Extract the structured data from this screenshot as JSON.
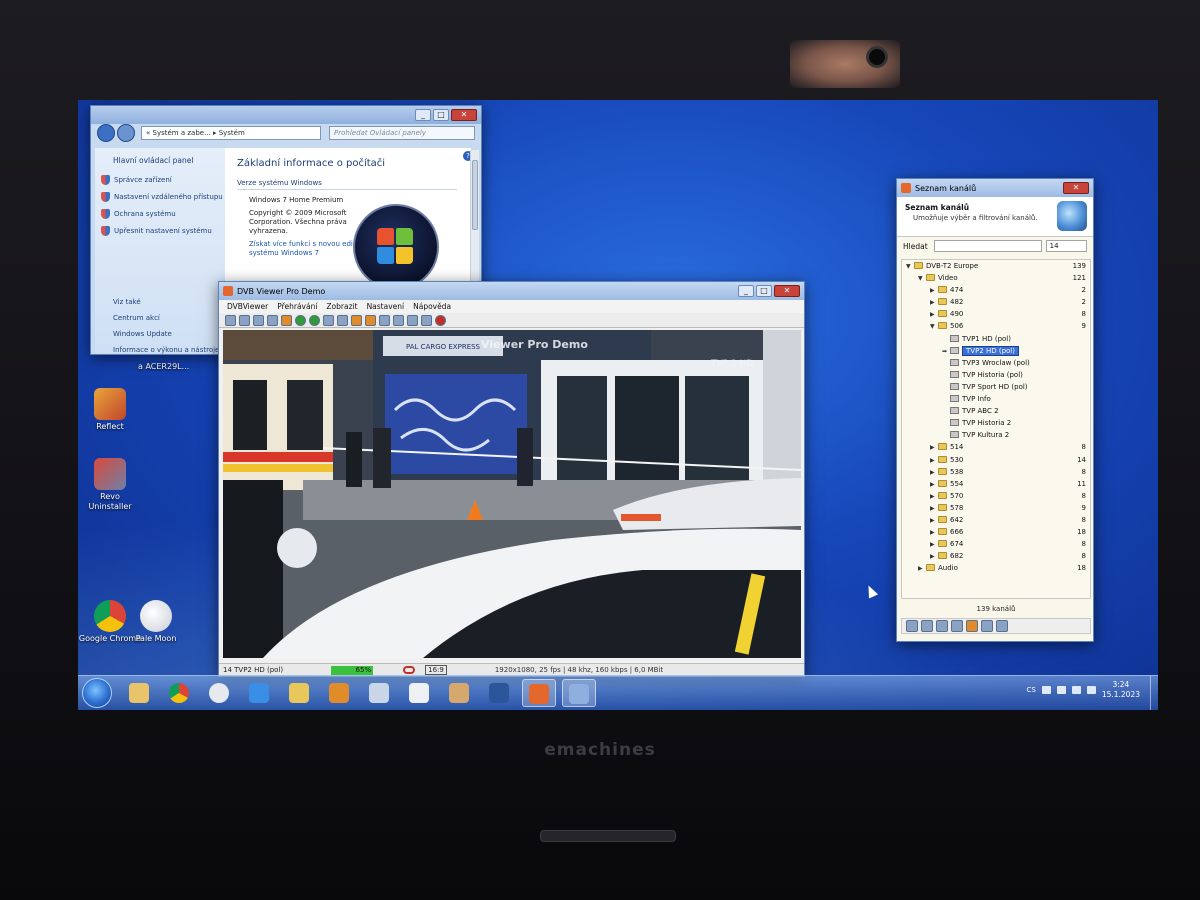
{
  "device": {
    "brand": "emachines"
  },
  "desktop": {
    "icons": [
      {
        "label": "Reflect"
      },
      {
        "label": "Revo Uninstaller"
      },
      {
        "label": "Google Chrome"
      },
      {
        "label": "Pale Moon"
      }
    ],
    "stray_label": "a ACER29L..."
  },
  "control_panel": {
    "address": "« Systém a zabe... ▸ Systém",
    "search_placeholder": "Prohledat Ovládací panely",
    "left": {
      "home": "Hlavní ovládací panel",
      "links": [
        "Správce zařízení",
        "Nastavení vzdáleného přístupu",
        "Ochrana systému",
        "Upřesnit nastavení systému"
      ],
      "see_also": "Viz také",
      "see_also_links": [
        "Centrum akcí",
        "Windows Update",
        "Informace o výkonu a nástroje"
      ]
    },
    "main": {
      "title": "Základní informace o počítači",
      "section": "Verze systému Windows",
      "edition": "Windows 7 Home Premium",
      "copyright": "Copyright © 2009 Microsoft Corporation. Všechna práva vyhrazena.",
      "more": "Získat více funkcí s novou edicí systému Windows 7"
    }
  },
  "dvb_viewer": {
    "title": "DVB Viewer Pro Demo",
    "menu": [
      "DVBViewer",
      "Přehrávání",
      "Zobrazit",
      "Nastavení",
      "Nápověda"
    ],
    "overlay_title": "Viewer Pro Demo",
    "osd_logo": "TVP 2 HD",
    "storefront_sign": "PAL CARGO EXPRESS",
    "status": {
      "channel": "14 TVP2 HD (pol)",
      "signal": "65%",
      "aspect": "16:9",
      "tech": "1920x1080, 25 fps | 48 khz, 160 kbps | 6,0 MBit"
    }
  },
  "channel_list": {
    "title": "Seznam kanálů",
    "header_title": "Seznam kanálů",
    "header_subtitle": "Umožňuje výběr a filtrování kanálů.",
    "search_label": "Hledat",
    "search_number": "14",
    "tree": [
      {
        "label": "DVB-T2 Europe",
        "count": "139",
        "level": 0,
        "kind": "folder",
        "open": true
      },
      {
        "label": "Video",
        "count": "121",
        "level": 1,
        "kind": "folder",
        "open": true
      },
      {
        "label": "474",
        "count": "2",
        "level": 2,
        "kind": "folder"
      },
      {
        "label": "482",
        "count": "2",
        "level": 2,
        "kind": "folder"
      },
      {
        "label": "490",
        "count": "8",
        "level": 2,
        "kind": "folder"
      },
      {
        "label": "506",
        "count": "9",
        "level": 2,
        "kind": "folder",
        "open": true
      },
      {
        "label": "TVP1 HD (pol)",
        "count": "",
        "level": 3,
        "kind": "tv"
      },
      {
        "label": "TVP2 HD (pol)",
        "count": "",
        "level": 3,
        "kind": "tv",
        "selected": true
      },
      {
        "label": "TVP3 Wroclaw (pol)",
        "count": "",
        "level": 3,
        "kind": "tv"
      },
      {
        "label": "TVP Historia (pol)",
        "count": "",
        "level": 3,
        "kind": "tv"
      },
      {
        "label": "TVP Sport HD (pol)",
        "count": "",
        "level": 3,
        "kind": "tv"
      },
      {
        "label": "TVP Info",
        "count": "",
        "level": 3,
        "kind": "tv"
      },
      {
        "label": "TVP ABC 2",
        "count": "",
        "level": 3,
        "kind": "tv"
      },
      {
        "label": "TVP Historia 2",
        "count": "",
        "level": 3,
        "kind": "tv"
      },
      {
        "label": "TVP Kultura 2",
        "count": "",
        "level": 3,
        "kind": "tv"
      },
      {
        "label": "514",
        "count": "8",
        "level": 2,
        "kind": "folder"
      },
      {
        "label": "530",
        "count": "14",
        "level": 2,
        "kind": "folder"
      },
      {
        "label": "538",
        "count": "8",
        "level": 2,
        "kind": "folder"
      },
      {
        "label": "554",
        "count": "11",
        "level": 2,
        "kind": "folder"
      },
      {
        "label": "570",
        "count": "8",
        "level": 2,
        "kind": "folder"
      },
      {
        "label": "578",
        "count": "9",
        "level": 2,
        "kind": "folder"
      },
      {
        "label": "642",
        "count": "8",
        "level": 2,
        "kind": "folder"
      },
      {
        "label": "666",
        "count": "18",
        "level": 2,
        "kind": "folder"
      },
      {
        "label": "674",
        "count": "8",
        "level": 2,
        "kind": "folder"
      },
      {
        "label": "682",
        "count": "8",
        "level": 2,
        "kind": "folder"
      },
      {
        "label": "Audio",
        "count": "18",
        "level": 1,
        "kind": "folder"
      }
    ],
    "footer": "139 kanálů"
  },
  "taskbar": {
    "pinned": [
      "windows-explorer-icon",
      "chrome-icon",
      "pale-moon-icon",
      "internet-explorer-icon",
      "folder-icon",
      "media-player-icon",
      "app-icon",
      "notepad-icon",
      "paint-icon",
      "word-icon",
      "dvbviewer-icon",
      "remote-desktop-icon"
    ],
    "language": "CS",
    "time": "3:24",
    "date": "15.1.2023"
  },
  "colors": {
    "selection": "#3a70d8",
    "desktop": "#1646b8",
    "close_button": "#c8433a"
  }
}
